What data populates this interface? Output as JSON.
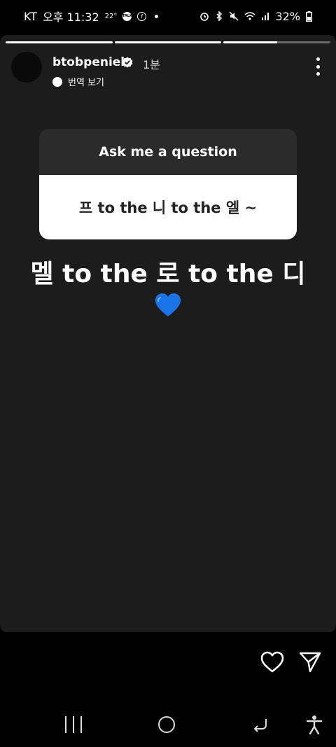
{
  "status_bar": {
    "carrier": "KT",
    "time": "오후 11:32",
    "temperature": "22°",
    "talk_label": "TALK",
    "facebook_label": "f",
    "battery": "32%"
  },
  "story": {
    "progress": [
      1,
      1,
      0.5
    ],
    "username": "btobpeniel",
    "time_ago": "1분",
    "translate_label": "번역 보기",
    "question_title": "Ask me a question",
    "question_text": "프 to the 니 to the 엘 ~",
    "answer_text": "멜 to the 로 to the 디",
    "heart_color": "#1a73e8"
  },
  "colors": {
    "background": "#000000",
    "story_bg": "#1c1c1c",
    "question_header": "#2b2b2b"
  }
}
